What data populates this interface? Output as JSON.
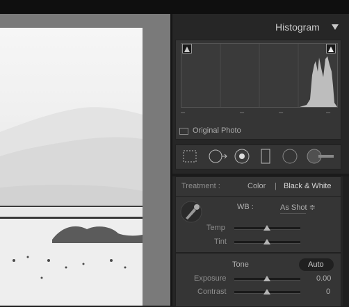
{
  "histogram": {
    "title": "Histogram",
    "tick_marks": [
      "–",
      "–",
      "–",
      "–"
    ],
    "original_photo_label": "Original Photo"
  },
  "tools": [
    "crop-overlay",
    "spot-removal",
    "red-eye",
    "graduated-filter",
    "radial-filter",
    "adjustment-brush"
  ],
  "basic": {
    "treatment_label": "Treatment :",
    "treatment_color": "Color",
    "treatment_separator": "|",
    "treatment_bw": "Black & White",
    "wb_label": "WB :",
    "wb_value": "As Shot ≑",
    "temp_label": "Temp",
    "tint_label": "Tint",
    "tone_label": "Tone",
    "auto_label": "Auto",
    "exposure_label": "Exposure",
    "exposure_value": "0.00",
    "contrast_label": "Contrast",
    "contrast_value": "0"
  },
  "colors": {
    "panel_bg": "#262626",
    "box_bg": "#353535",
    "text": "#b0b0b0",
    "histogram_fill": "#bdbdbd"
  }
}
